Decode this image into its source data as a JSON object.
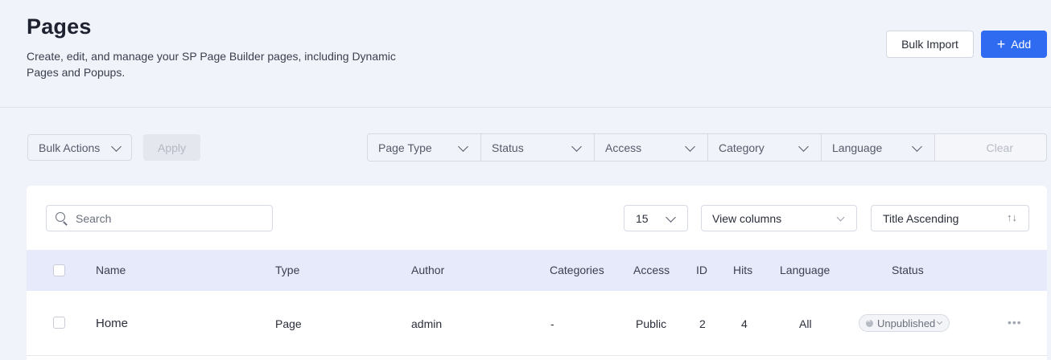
{
  "header": {
    "title": "Pages",
    "subtitle": "Create, edit, and manage your SP Page Builder pages, including Dynamic Pages and Popups.",
    "bulk_import_label": "Bulk Import",
    "add_label": "Add",
    "add_icon": "+"
  },
  "toolbar": {
    "bulk_actions_label": "Bulk Actions",
    "apply_label": "Apply",
    "filters": [
      "Page Type",
      "Status",
      "Access",
      "Category",
      "Language"
    ],
    "clear_label": "Clear"
  },
  "list": {
    "search_placeholder": "Search",
    "per_page": "15",
    "view_columns_label": "View columns",
    "sort_label": "Title Ascending",
    "sort_icon": "↑↓",
    "columns": [
      "Name",
      "Type",
      "Author",
      "Categories",
      "Access",
      "ID",
      "Hits",
      "Language",
      "Status"
    ],
    "rows": [
      {
        "name": "Home",
        "type": "Page",
        "author": "admin",
        "categories": "-",
        "access": "Public",
        "id": "2",
        "hits": "4",
        "language": "All",
        "status": "Unpublished",
        "more": "•••"
      }
    ]
  },
  "colors": {
    "accent": "#2f6bf0",
    "page_bg": "#f1f3fa",
    "table_header_bg": "#e6eafb"
  }
}
